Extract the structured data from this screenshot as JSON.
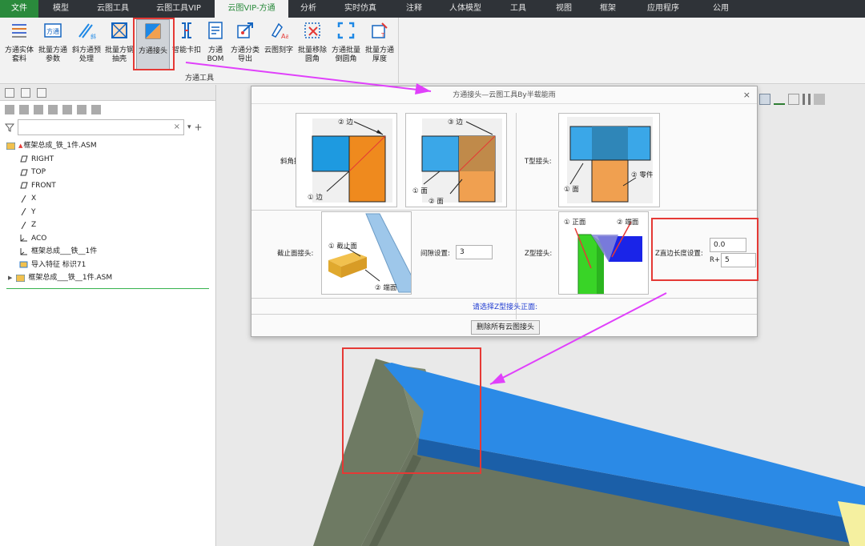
{
  "menu": {
    "tabs": [
      "文件",
      "模型",
      "云图工具",
      "云图工具VIP",
      "云图VIP-方通",
      "分析",
      "实时仿真",
      "注释",
      "人体模型",
      "工具",
      "视图",
      "框架",
      "应用程序",
      "公用"
    ]
  },
  "ribbon": {
    "buttons": [
      {
        "line1": "方通实体",
        "line2": "套料",
        "icon": "stack-lines-icon"
      },
      {
        "line1": "批量方通",
        "line2": "参数",
        "icon": "fangtong-tag-icon"
      },
      {
        "line1": "斜方通预",
        "line2": "处理",
        "icon": "oblique-tube-icon"
      },
      {
        "line1": "批量方钢",
        "line2": "抽壳",
        "icon": "shell-box-icon"
      },
      {
        "line1": "方通接头",
        "line2": "",
        "icon": "joint-icon"
      },
      {
        "line1": "智能卡扣",
        "line2": "",
        "icon": "snap-clip-icon"
      },
      {
        "line1": "方通",
        "line2": "BOM",
        "icon": "bom-icon"
      },
      {
        "line1": "方通分类",
        "line2": "导出",
        "icon": "export-icon"
      },
      {
        "line1": "云图刻字",
        "line2": "",
        "icon": "engrave-text-icon"
      },
      {
        "line1": "批量移除",
        "line2": "圆角",
        "icon": "remove-fillet-icon"
      },
      {
        "line1": "方通批量",
        "line2": "倒圆角",
        "icon": "fillet-corner-icon"
      },
      {
        "line1": "批量方通",
        "line2": "厚度",
        "icon": "thickness-icon"
      }
    ],
    "group_title": "方通工具"
  },
  "tree": {
    "items": [
      {
        "label": "框架总成_铁_1件.ASM",
        "icon": "assembly-icon"
      },
      {
        "label": "RIGHT",
        "icon": "datum-plane-icon"
      },
      {
        "label": "TOP",
        "icon": "datum-plane-icon"
      },
      {
        "label": "FRONT",
        "icon": "datum-plane-icon"
      },
      {
        "label": "X",
        "icon": "axis-icon"
      },
      {
        "label": "Y",
        "icon": "axis-icon"
      },
      {
        "label": "Z",
        "icon": "axis-icon"
      },
      {
        "label": "ACO",
        "icon": "csys-icon"
      },
      {
        "label": "框架总成___铁__1件",
        "icon": "csys-icon"
      },
      {
        "label": "导入特征 标识71",
        "icon": "import-feature-icon"
      },
      {
        "label": "框架总成___铁__1件.ASM",
        "icon": "assembly-icon"
      }
    ]
  },
  "dialog": {
    "title": "方通接头—云图工具By半载能雨",
    "close": "×",
    "bevel_label": "斜角接头:",
    "bevel1": {
      "edge": "② 边",
      "edge1": "① 边"
    },
    "bevel2": {
      "edge": "③ 边",
      "face1": "① 面",
      "face2": "② 面"
    },
    "t_label": "T型接头:",
    "t_joint": {
      "part": "② 零件",
      "face": "① 面"
    },
    "cut_label": "截止面接头:",
    "cut": {
      "stop": "① 截止面",
      "end": "② 端面"
    },
    "gap_label": "间隙设置:",
    "gap_value": "3",
    "z_label": "Z型接头:",
    "z_joint": {
      "front": "① 正面",
      "end": "② 端面"
    },
    "z_len_label": "Z直边长度设置:",
    "z_len_value": "0.0",
    "r_label": "R+",
    "r_value": "5",
    "prompt": "请选择Z型接头正面:",
    "delete_button": "删除所有云图接头"
  },
  "colors": {
    "accent": "#2a8a3c",
    "highlight": "#e53935",
    "arrow": "#e040fb",
    "beam_blue": "#2b8ae6",
    "beam_olive": "#6e7a63"
  }
}
